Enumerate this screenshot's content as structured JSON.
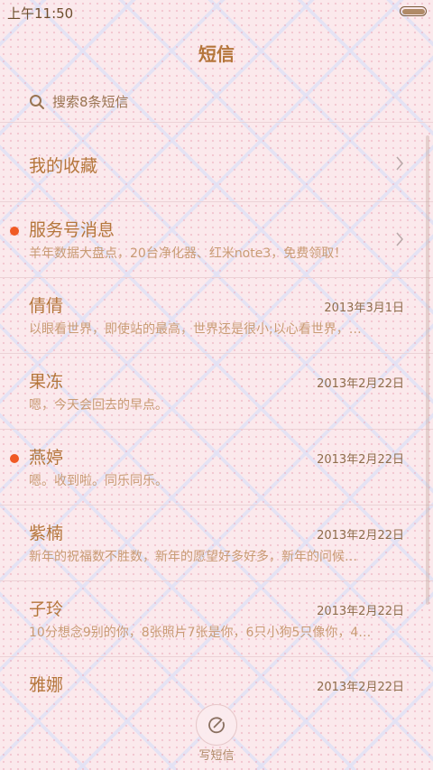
{
  "status_bar": {
    "time": "上午11:50",
    "battery_level": 1.0
  },
  "header": {
    "title": "短信"
  },
  "search": {
    "placeholder": "搜索8条短信",
    "icon": "search-icon"
  },
  "favorites": {
    "label": "我的收藏",
    "icon": "chevron-right-icon"
  },
  "service": {
    "title": "服务号消息",
    "snippet": "羊年数据大盘点，20台净化器、红米note3，免费领取！",
    "unread": true,
    "icon": "chevron-right-icon"
  },
  "conversations": [
    {
      "name": "倩倩",
      "date": "2013年3月1日",
      "snippet": "以眼看世界，即使站的最高，世界还是很小;以心看世界，…",
      "unread": false
    },
    {
      "name": "果冻",
      "date": "2013年2月22日",
      "snippet": "嗯，今天会回去的早点。",
      "unread": false
    },
    {
      "name": "燕婷",
      "date": "2013年2月22日",
      "snippet": "嗯。收到啦。同乐同乐。",
      "unread": true
    },
    {
      "name": "紫楠",
      "date": "2013年2月22日",
      "snippet": "新年的祝福数不胜数，新年的愿望好多好多，新年的问候…",
      "unread": false
    },
    {
      "name": "子玲",
      "date": "2013年2月22日",
      "snippet": "10分想念9别的你，8张照片7张是你，6只小狗5只像你，4…",
      "unread": false
    },
    {
      "name": "雅娜",
      "date": "2013年2月22日",
      "snippet": "",
      "unread": false
    }
  ],
  "compose": {
    "label": "写短信",
    "icon": "compose-icon"
  },
  "colors": {
    "accent": "#b5763b",
    "unread_dot": "#f05a24",
    "background": "#fbe9ec"
  }
}
